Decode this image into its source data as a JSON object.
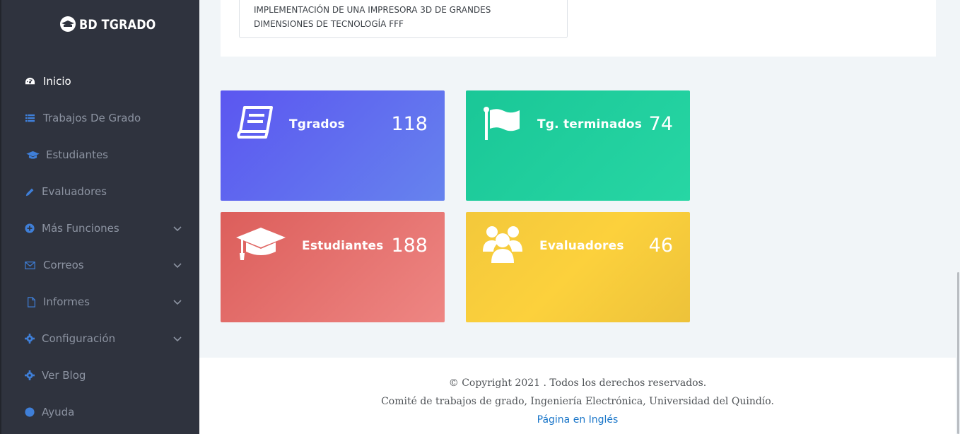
{
  "brand": {
    "name": "BD TGRADO",
    "icon": "graduation-cap-icon"
  },
  "sidebar": {
    "items": [
      {
        "label": "Inicio",
        "icon": "dashboard-icon",
        "active": true,
        "has_submenu": false
      },
      {
        "label": "Trabajos De Grado",
        "icon": "list-icon",
        "active": false,
        "has_submenu": false
      },
      {
        "label": "Estudiantes",
        "icon": "graduation-cap-icon",
        "active": false,
        "has_submenu": false
      },
      {
        "label": "Evaluadores",
        "icon": "pencil-icon",
        "active": false,
        "has_submenu": false
      },
      {
        "label": "Más Funciones",
        "icon": "plus-circle-icon",
        "active": false,
        "has_submenu": true
      },
      {
        "label": "Correos",
        "icon": "envelope-icon",
        "active": false,
        "has_submenu": true
      },
      {
        "label": "Informes",
        "icon": "file-icon",
        "active": false,
        "has_submenu": true
      },
      {
        "label": "Configuración",
        "icon": "gear-icon",
        "active": false,
        "has_submenu": true
      },
      {
        "label": "Ver Blog",
        "icon": "gear-icon",
        "active": false,
        "has_submenu": false
      },
      {
        "label": "Ayuda",
        "icon": "help-icon",
        "active": false,
        "has_submenu": false
      }
    ]
  },
  "project": {
    "line1": "IMPLEMENTACIÓN DE UNA IMPRESORA 3D DE GRANDES",
    "line2": "DIMENSIONES DE TECNOLOGÍA FFF"
  },
  "stats": {
    "tgrados": {
      "label": "Tgrados",
      "value": "118",
      "icon": "book-icon",
      "color": "#5b64ef"
    },
    "terminados": {
      "label": "Tg. terminados",
      "value": "74",
      "icon": "flag-icon",
      "color": "#20cd9e"
    },
    "estudiantes": {
      "label": "Estudiantes",
      "value": "188",
      "icon": "graduation-cap-icon",
      "color": "#e46f6c"
    },
    "evaluadores": {
      "label": "Evaluadores",
      "value": "46",
      "icon": "users-icon",
      "color": "#f6cb3c"
    }
  },
  "footer": {
    "copyright": "© Copyright 2021 . Todos los derechos reservados.",
    "committee": "Comité de trabajos de grado, Ingeniería Electrónica, Universidad del Quindío.",
    "english_link": "Página en Inglés"
  }
}
